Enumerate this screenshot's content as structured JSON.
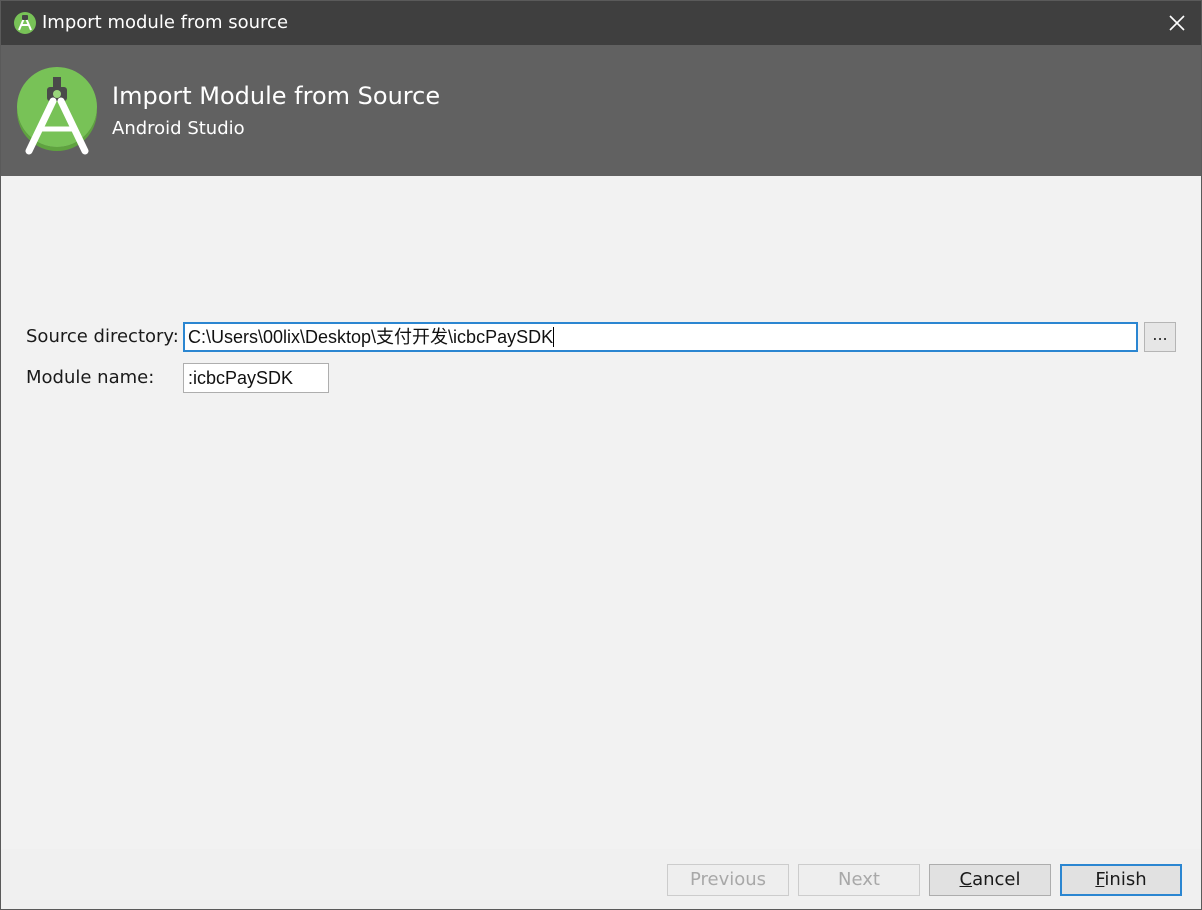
{
  "window": {
    "title": "Import module from source"
  },
  "banner": {
    "heading": "Import Module from Source",
    "subheading": "Android Studio"
  },
  "form": {
    "source_directory_label": "Source directory:",
    "source_directory_value": "C:\\Users\\00lix\\Desktop\\支付开发\\icbcPaySDK",
    "browse_label": "...",
    "module_name_label": "Module name:",
    "module_name_value": ":icbcPaySDK"
  },
  "footer": {
    "previous_label": "Previous",
    "next_label": "Next",
    "cancel_mnemonic": "C",
    "cancel_rest": "ancel",
    "finish_mnemonic": "F",
    "finish_rest": "inish"
  },
  "colors": {
    "titlebar": "#3f3f3f",
    "banner": "#616161",
    "android_green": "#78c257",
    "focus_blue": "#2b86d1"
  },
  "icons": {
    "app": "android-studio-icon",
    "close": "close-icon",
    "logo": "android-studio-logo"
  }
}
